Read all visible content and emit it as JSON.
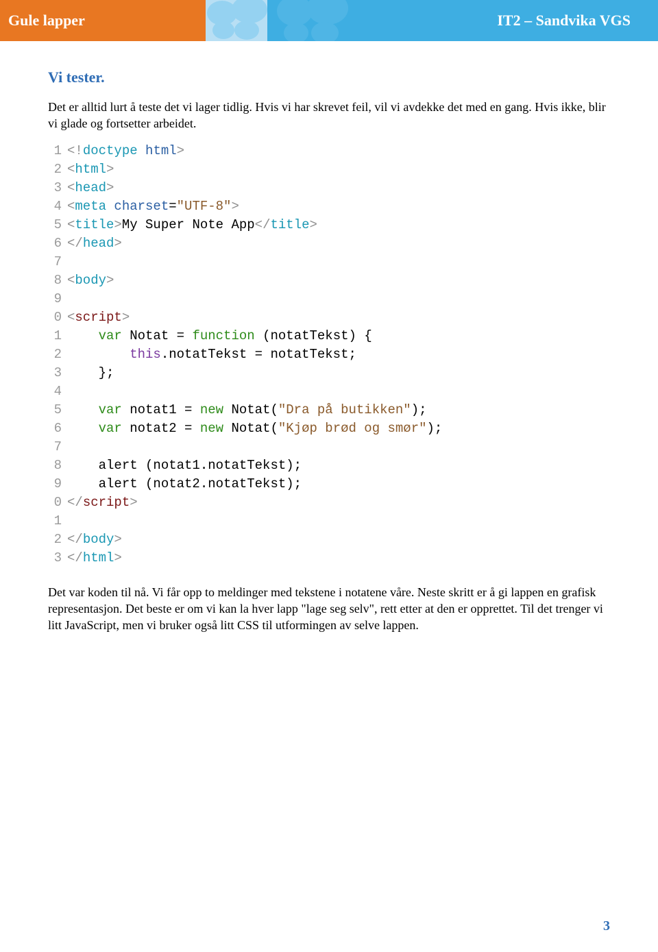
{
  "header": {
    "left": "Gule lapper",
    "right": "IT2 – Sandvika VGS"
  },
  "page_number": "3",
  "section_heading": "Vi tester.",
  "para1": "Det er alltid lurt å teste det vi lager tidlig. Hvis vi har skrevet feil, vil vi avdekke det med en gang. Hvis ikke, blir vi glade og fortsetter arbeidet.",
  "para2": "Det var koden til nå. Vi får opp to meldinger med tekstene i notatene våre. Neste skritt er å gi lappen en grafisk representasjon. Det beste er om vi kan la hver lapp \"lage seg selv\", rett etter at den er opprettet. Til det trenger vi litt JavaScript, men vi bruker også litt CSS til utformingen av selve lappen.",
  "code": {
    "gutter": [
      "1",
      "2",
      "3",
      "4",
      "5",
      "6",
      "7",
      "8",
      "9",
      "0",
      "1",
      "2",
      "3",
      "4",
      "5",
      "6",
      "7",
      "8",
      "9",
      "0",
      "1",
      "2",
      "3"
    ],
    "lines": [
      {
        "indent": 0,
        "tokens": [
          {
            "t": "<!",
            "c": "d-gray"
          },
          {
            "t": "doctype",
            "c": "d-cyan"
          },
          {
            "t": " html",
            "c": "d-blue"
          },
          {
            "t": ">",
            "c": "d-gray"
          }
        ]
      },
      {
        "indent": 0,
        "tokens": [
          {
            "t": "<",
            "c": "d-gray"
          },
          {
            "t": "html",
            "c": "d-cyan"
          },
          {
            "t": ">",
            "c": "d-gray"
          }
        ]
      },
      {
        "indent": 0,
        "tokens": [
          {
            "t": "<",
            "c": "d-gray"
          },
          {
            "t": "head",
            "c": "d-cyan"
          },
          {
            "t": ">",
            "c": "d-gray"
          }
        ]
      },
      {
        "indent": 0,
        "tokens": [
          {
            "t": "<",
            "c": "d-gray"
          },
          {
            "t": "meta",
            "c": "d-cyan"
          },
          {
            "t": " charset",
            "c": "d-blue"
          },
          {
            "t": "=",
            "c": "d-black"
          },
          {
            "t": "\"UTF-8\"",
            "c": "d-brown"
          },
          {
            "t": ">",
            "c": "d-gray"
          }
        ]
      },
      {
        "indent": 0,
        "tokens": [
          {
            "t": "<",
            "c": "d-gray"
          },
          {
            "t": "title",
            "c": "d-cyan"
          },
          {
            "t": ">",
            "c": "d-gray"
          },
          {
            "t": "My Super Note App",
            "c": "d-black"
          },
          {
            "t": "</",
            "c": "d-gray"
          },
          {
            "t": "title",
            "c": "d-cyan"
          },
          {
            "t": ">",
            "c": "d-gray"
          }
        ]
      },
      {
        "indent": 0,
        "tokens": [
          {
            "t": "</",
            "c": "d-gray"
          },
          {
            "t": "head",
            "c": "d-cyan"
          },
          {
            "t": ">",
            "c": "d-gray"
          }
        ]
      },
      {
        "indent": 0,
        "tokens": []
      },
      {
        "indent": 0,
        "tokens": [
          {
            "t": "<",
            "c": "d-gray"
          },
          {
            "t": "body",
            "c": "d-cyan"
          },
          {
            "t": ">",
            "c": "d-gray"
          }
        ]
      },
      {
        "indent": 0,
        "tokens": []
      },
      {
        "indent": 0,
        "tokens": [
          {
            "t": "<",
            "c": "d-gray"
          },
          {
            "t": "script",
            "c": "d-darkred"
          },
          {
            "t": ">",
            "c": "d-gray"
          }
        ]
      },
      {
        "indent": 1,
        "tokens": [
          {
            "t": "var ",
            "c": "d-green"
          },
          {
            "t": "Notat ",
            "c": "d-black"
          },
          {
            "t": "= ",
            "c": "d-black"
          },
          {
            "t": "function ",
            "c": "d-green"
          },
          {
            "t": "(",
            "c": "d-black"
          },
          {
            "t": "notatTekst",
            "c": "d-black"
          },
          {
            "t": ") {",
            "c": "d-black"
          }
        ]
      },
      {
        "indent": 2,
        "tokens": [
          {
            "t": "this",
            "c": "d-purple"
          },
          {
            "t": ".notatTekst = notatTekst;",
            "c": "d-black"
          }
        ]
      },
      {
        "indent": 1,
        "tokens": [
          {
            "t": "};",
            "c": "d-black"
          }
        ]
      },
      {
        "indent": 0,
        "tokens": []
      },
      {
        "indent": 1,
        "tokens": [
          {
            "t": "var ",
            "c": "d-green"
          },
          {
            "t": "notat1 = ",
            "c": "d-black"
          },
          {
            "t": "new ",
            "c": "d-green"
          },
          {
            "t": "Notat(",
            "c": "d-black"
          },
          {
            "t": "\"Dra på butikken\"",
            "c": "d-brown"
          },
          {
            "t": ");",
            "c": "d-black"
          }
        ]
      },
      {
        "indent": 1,
        "tokens": [
          {
            "t": "var ",
            "c": "d-green"
          },
          {
            "t": "notat2 = ",
            "c": "d-black"
          },
          {
            "t": "new ",
            "c": "d-green"
          },
          {
            "t": "Notat(",
            "c": "d-black"
          },
          {
            "t": "\"Kjøp brød og smør\"",
            "c": "d-brown"
          },
          {
            "t": ");",
            "c": "d-black"
          }
        ]
      },
      {
        "indent": 0,
        "tokens": []
      },
      {
        "indent": 1,
        "tokens": [
          {
            "t": "alert (notat1.notatTekst);",
            "c": "d-black"
          }
        ]
      },
      {
        "indent": 1,
        "tokens": [
          {
            "t": "alert (notat2.notatTekst);",
            "c": "d-black"
          }
        ]
      },
      {
        "indent": 0,
        "tokens": [
          {
            "t": "</",
            "c": "d-gray"
          },
          {
            "t": "script",
            "c": "d-darkred"
          },
          {
            "t": ">",
            "c": "d-gray"
          }
        ]
      },
      {
        "indent": 0,
        "tokens": []
      },
      {
        "indent": 0,
        "tokens": [
          {
            "t": "</",
            "c": "d-gray"
          },
          {
            "t": "body",
            "c": "d-cyan"
          },
          {
            "t": ">",
            "c": "d-gray"
          }
        ]
      },
      {
        "indent": 0,
        "tokens": [
          {
            "t": "</",
            "c": "d-gray"
          },
          {
            "t": "html",
            "c": "d-cyan"
          },
          {
            "t": ">",
            "c": "d-gray"
          }
        ]
      }
    ]
  }
}
